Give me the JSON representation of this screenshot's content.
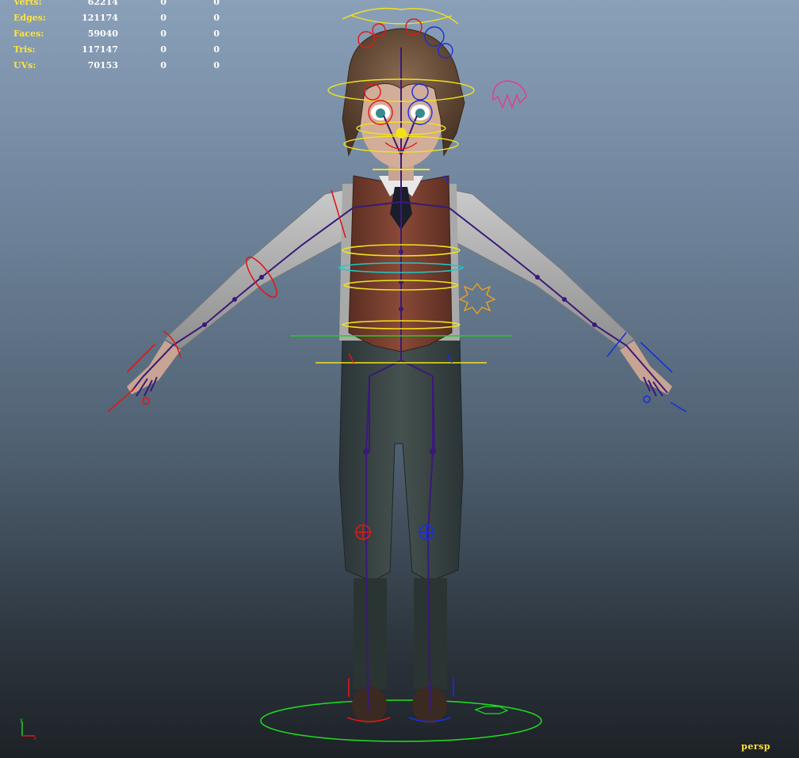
{
  "hud": {
    "rows": [
      {
        "label": "Verts:",
        "v1": "62214",
        "v2": "0",
        "v3": "0"
      },
      {
        "label": "Edges:",
        "v1": "121174",
        "v2": "0",
        "v3": "0"
      },
      {
        "label": "Faces:",
        "v1": "59040",
        "v2": "0",
        "v3": "0"
      },
      {
        "label": "Tris:",
        "v1": "117147",
        "v2": "0",
        "v3": "0"
      },
      {
        "label": "UVs:",
        "v1": "70153",
        "v2": "0",
        "v3": "0"
      }
    ]
  },
  "camera": {
    "name": "persp"
  },
  "colors": {
    "hud_label": "#ffe43a",
    "hud_value": "#ffffff",
    "joint": "#3a1a78",
    "ctrl_yellow": "#f2e21a",
    "ctrl_red": "#e01818",
    "ctrl_blue": "#1a2ee0",
    "ctrl_green": "#20d020",
    "ctrl_cyan": "#20c8c8",
    "ctrl_pink": "#e0408a",
    "ctrl_orange": "#f0a020"
  }
}
